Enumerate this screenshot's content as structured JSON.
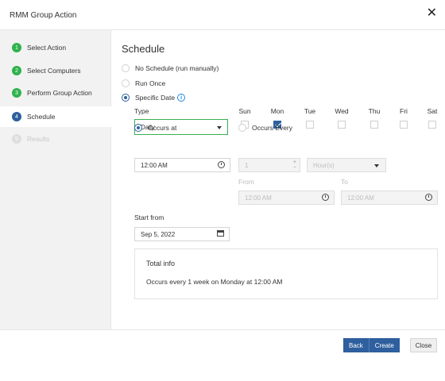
{
  "dialog": {
    "title": "RMM Group Action",
    "close_glyph": "✕"
  },
  "steps": [
    {
      "num": "1",
      "label": "Select Action",
      "state": "done"
    },
    {
      "num": "2",
      "label": "Select Computers",
      "state": "done"
    },
    {
      "num": "3",
      "label": "Perform Group Action",
      "state": "done"
    },
    {
      "num": "4",
      "label": "Schedule",
      "state": "current"
    },
    {
      "num": "5",
      "label": "Results",
      "state": "pending"
    }
  ],
  "schedule": {
    "heading": "Schedule",
    "options": {
      "no_schedule": "No Schedule (run manually)",
      "run_once": "Run Once",
      "specific_date": "Specific Date",
      "selected": "specific_date"
    },
    "info_glyph": "i",
    "type_label": "Type",
    "type_value": "Daily",
    "days": [
      {
        "label": "Sun",
        "checked": false
      },
      {
        "label": "Mon",
        "checked": true
      },
      {
        "label": "Tue",
        "checked": false
      },
      {
        "label": "Wed",
        "checked": false
      },
      {
        "label": "Thu",
        "checked": false
      },
      {
        "label": "Fri",
        "checked": false
      },
      {
        "label": "Sat",
        "checked": false
      }
    ],
    "occurs_at_label": "Occurs at",
    "occurs_at_value": "12:00 AM",
    "occurs_every_label": "Occurs Every",
    "occurs_every_value": "1",
    "occurs_every_unit": "Hour(s)",
    "from_label": "From",
    "from_value": "12:00 AM",
    "to_label": "To",
    "to_value": "12:00 AM",
    "start_from_label": "Start from",
    "start_from_value": "Sep 5, 2022",
    "stepper_up": "+",
    "stepper_down": "−"
  },
  "total_info": {
    "title": "Total info",
    "text": "Occurs every 1 week on Monday at 12:00 AM"
  },
  "footer": {
    "back": "Back",
    "create": "Create",
    "close": "Close"
  },
  "colors": {
    "primary": "#2e5f9e",
    "step_done": "#2fb24c",
    "select_border": "#37b04f"
  }
}
